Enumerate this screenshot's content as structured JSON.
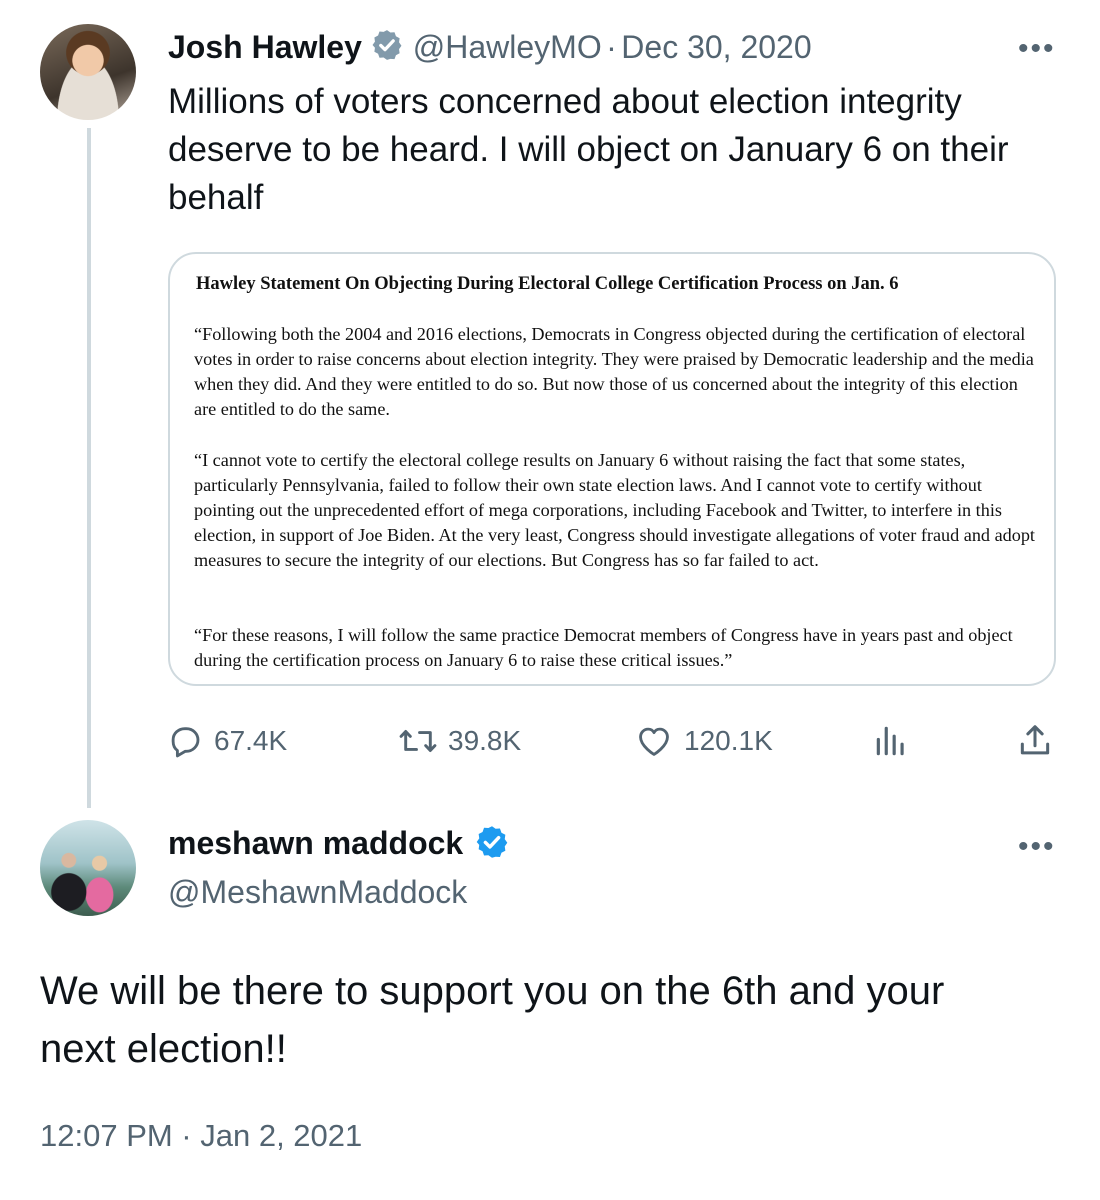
{
  "tweet1": {
    "author_name": "Josh Hawley",
    "handle": "@HawleyMO",
    "separator": "·",
    "date": "Dec 30, 2020",
    "text_lines": [
      "Millions of voters concerned about election integrity",
      "deserve to be heard. I will object on January 6 on their",
      "behalf"
    ],
    "document": {
      "title": "Hawley Statement On Objecting During Electoral College Certification Process on Jan. 6",
      "paragraphs": [
        "“Following both the 2004 and 2016 elections, Democrats in Congress objected during the certification of electoral votes in order to raise concerns about election integrity. They were praised by Democratic leadership and the media when they did. And they were entitled to do so. But now those of us concerned about the integrity of this election are entitled to do the same.",
        "“I cannot vote to certify the electoral college results on January 6 without raising the fact that some states, particularly Pennsylvania, failed to follow their own state election laws. And I cannot vote to certify without pointing out the unprecedented effort of mega corporations, including Facebook and Twitter, to interfere in this election, in support of Joe Biden. At the very least, Congress should investigate allegations of voter fraud and adopt measures to secure the integrity of our elections. But Congress has so far failed to act.",
        "“For these reasons, I will follow the same practice Democrat members of Congress have in years past and object during the certification process on January 6 to raise these critical issues.”"
      ]
    },
    "actions": {
      "replies": "67.4K",
      "retweets": "39.8K",
      "likes": "120.1K"
    },
    "more_label": "•••"
  },
  "tweet2": {
    "author_name": "meshawn maddock",
    "handle": "@MeshawnMaddock",
    "text_lines": [
      "We will be there to support you on the 6th and your",
      "next election!!"
    ],
    "timestamp": "12:07 PM · Jan 2, 2021",
    "more_label": "•••"
  },
  "colors": {
    "verified_gray": "#829aab",
    "verified_blue": "#1d9bf0",
    "secondary_text": "#536471",
    "thread_line": "#cfd9de"
  },
  "icons": [
    "reply-icon",
    "retweet-icon",
    "like-icon",
    "analytics-icon",
    "share-icon",
    "verified-badge-icon",
    "more-icon"
  ]
}
